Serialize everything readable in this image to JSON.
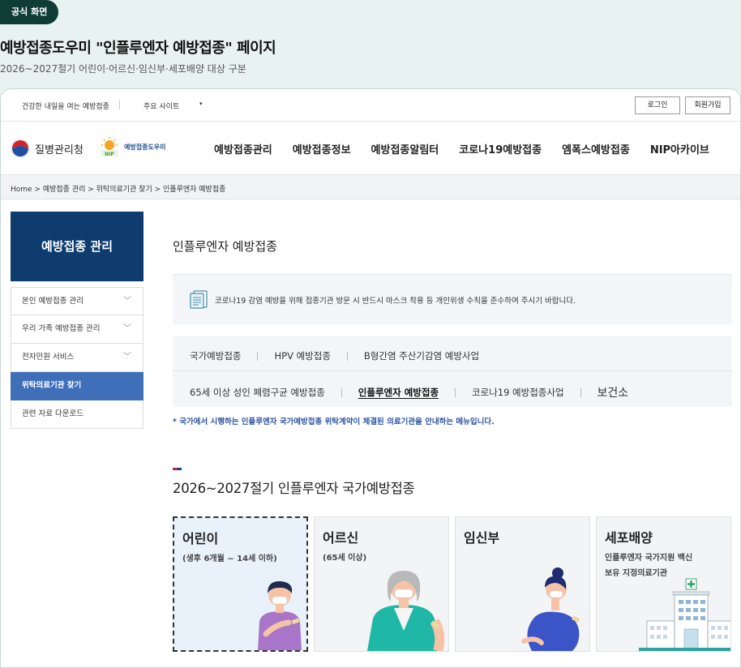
{
  "badge": "공식 화면",
  "title": "예방접종도우미 \"인플루엔자 예방접종\" 페이지",
  "subtitle": "2026~2027절기 어린이·어르신·임신부·세포배양 대상 구분",
  "utility": {
    "slogan": "건강한 내일을 여는 예방접종",
    "sites": "주요 사이트",
    "caret": "▾",
    "login": "로그인",
    "join": "회원가입"
  },
  "logos": {
    "kdca": "질병관리청",
    "nip": "예방접종도우미"
  },
  "gnb": [
    "예방접종관리",
    "예방접종정보",
    "예방접종알림터",
    "코로나19예방접종",
    "엠폭스예방접종",
    "NIP아카이브"
  ],
  "breadcrumb": "Home  >  예방접종 관리  >  위탁의료기관 찾기  >  인플루엔자 예방접종",
  "sidebar": {
    "title": "예방접종 관리",
    "items": [
      {
        "label": "본인 예방접종 관리",
        "chev": "﹀"
      },
      {
        "label": "우리 가족 예방접종 관리",
        "chev": "﹀"
      },
      {
        "label": "전자민원 서비스",
        "chev": "﹀"
      },
      {
        "label": "위탁의료기관 찾기",
        "chev": ""
      },
      {
        "label": "관련 자료 다운로드",
        "chev": ""
      }
    ]
  },
  "main": {
    "title": "인플루엔자 예방접종",
    "notice": "코로나19 감염 예방을 위해 접종기관 방문 시 반드시 마스크 착용 등 개인위생 수칙을 준수하여 주시기 바랍니다.",
    "tabs_row1": [
      "국가예방접종",
      "HPV 예방접종",
      "B형간염 주산기감염 예방사업"
    ],
    "tabs_row2": [
      "65세 이상 성인 폐렴구균 예방접종",
      "인플루엔자 예방접종",
      "코로나19 예방접종사업",
      "보건소"
    ],
    "note": "* 국가에서 시행하는 인플루엔자 국가예방접종 위탁계약이 체결된 의료기관을 안내하는 메뉴입니다.",
    "section_title": "2026~2027절기 인플루엔자 국가예방접종",
    "cards": [
      {
        "title": "어린이",
        "sub1": "(생후 6개월 ~ 14세 이하)",
        "sub2": ""
      },
      {
        "title": "어르신",
        "sub1": "(65세 이상)",
        "sub2": ""
      },
      {
        "title": "임신부",
        "sub1": "",
        "sub2": ""
      },
      {
        "title": "세포배양",
        "sub1": "인플루엔자 국가지원 백신",
        "sub2": "보유 지정의료기관"
      }
    ]
  }
}
